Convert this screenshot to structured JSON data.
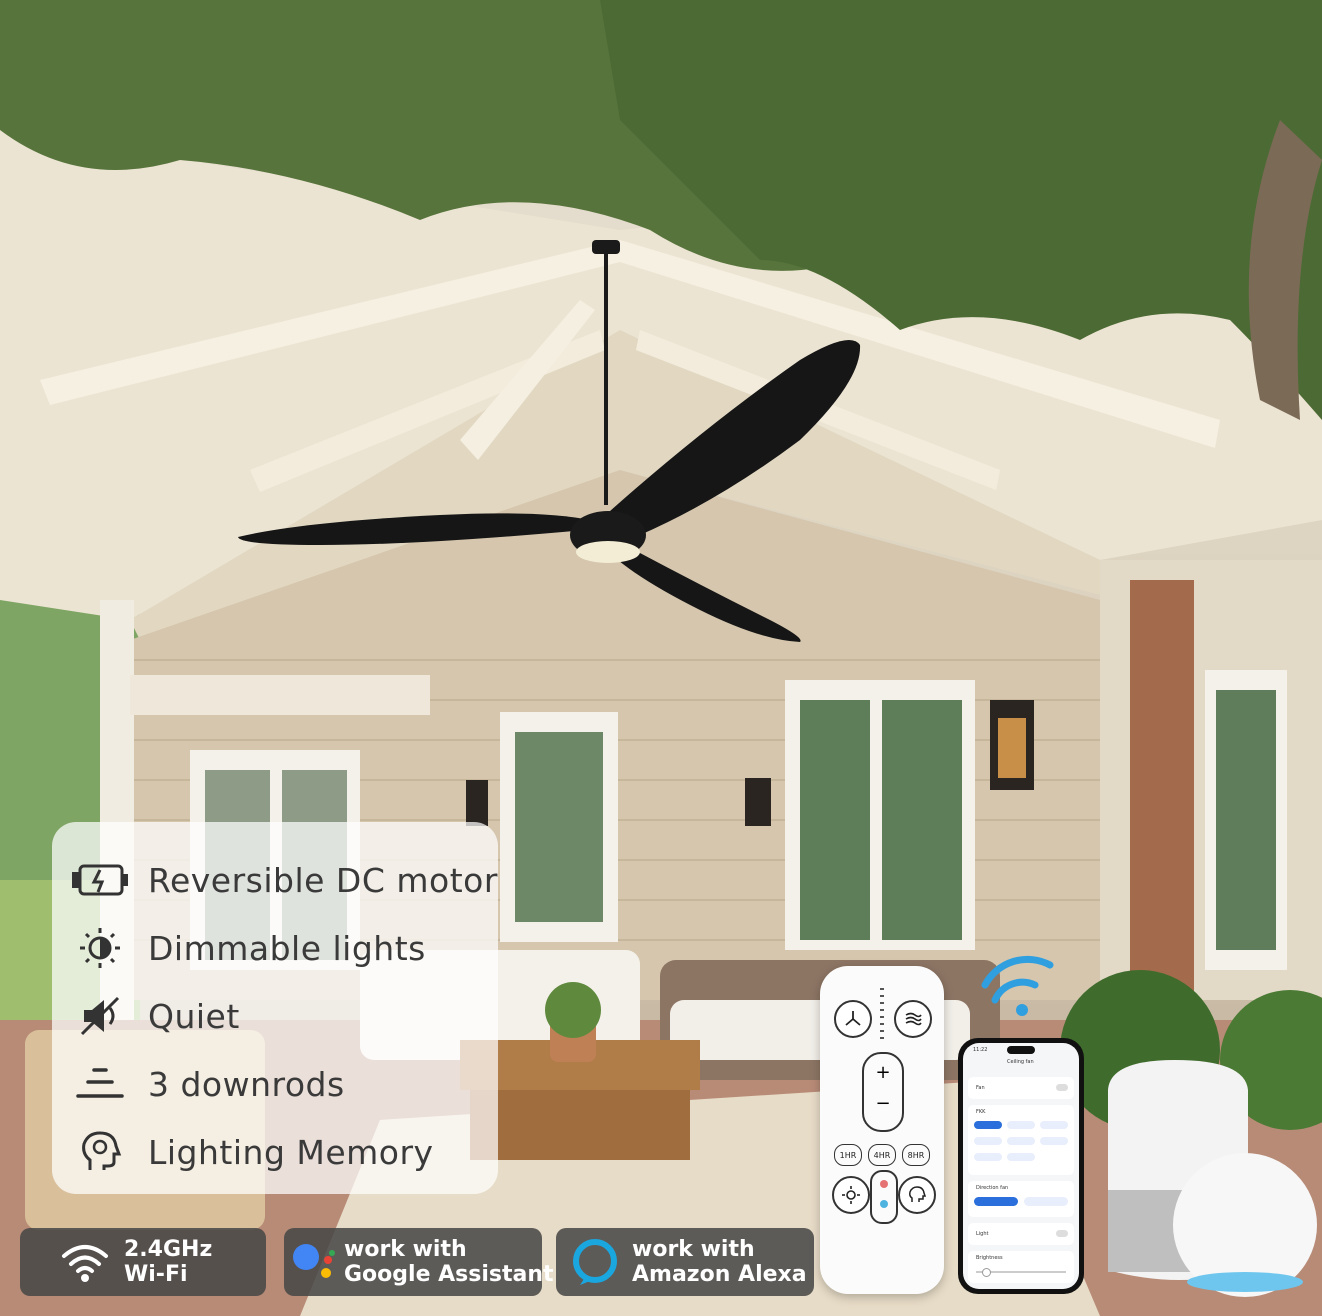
{
  "features": [
    {
      "icon": "dc-motor-icon",
      "label": "Reversible DC motor"
    },
    {
      "icon": "dimmable-light-icon",
      "label": "Dimmable lights"
    },
    {
      "icon": "quiet-mute-icon",
      "label": "Quiet"
    },
    {
      "icon": "downrods-icon",
      "label": "3 downrods"
    },
    {
      "icon": "lighting-memory-icon",
      "label": "Lighting Memory"
    }
  ],
  "badges": {
    "wifi": {
      "icon": "wifi-icon",
      "line1": "2.4GHz",
      "line2": "Wi-Fi"
    },
    "google": {
      "icon": "google-assistant-icon",
      "line1": "work with",
      "line2": "Google  Assistant"
    },
    "alexa": {
      "icon": "amazon-alexa-icon",
      "line1": "work with",
      "line2": "Amazon Alexa"
    }
  },
  "remote": {
    "plus": "+",
    "minus": "−",
    "timers": [
      "1HR",
      "4HR",
      "8HR"
    ]
  },
  "phone": {
    "time": "11:22",
    "title": "Ceiling fan",
    "fan_label": "Fan",
    "fan_speed_label": "FKK",
    "direction_label": "Direction fan",
    "light_label": "Light",
    "brightness_label": "Brightness"
  },
  "colors": {
    "badge_bg": "#464646",
    "panel_bg": "#ffffff",
    "fan_black": "#1a1a1a",
    "wifi_blue": "#2f9fe0",
    "alexa_blue": "#1aa7e0"
  }
}
